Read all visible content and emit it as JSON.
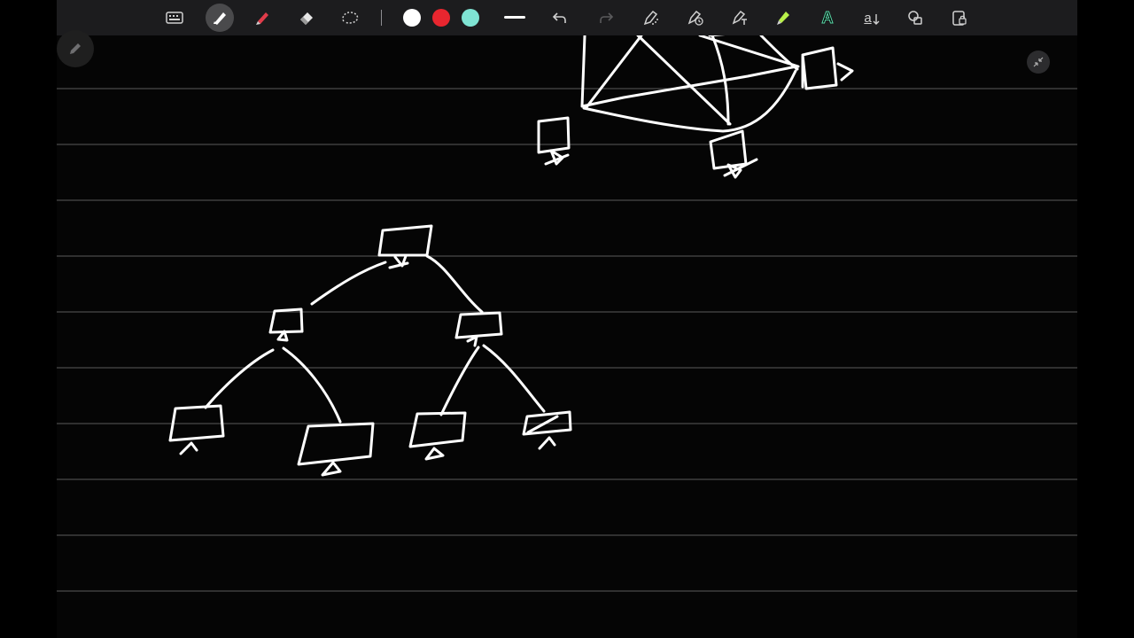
{
  "toolbar": {
    "tools": [
      {
        "name": "keyboard-icon",
        "active": false
      },
      {
        "name": "pen-icon",
        "active": true
      },
      {
        "name": "highlighter-icon",
        "active": false
      },
      {
        "name": "eraser-icon",
        "active": false
      },
      {
        "name": "lasso-icon",
        "active": false
      }
    ],
    "colors": {
      "white": "#ffffff",
      "red": "#e8262f",
      "teal": "#7fe3d3"
    },
    "stroke_width_icon": "stroke-width-icon",
    "undo_icon": "undo-icon",
    "redo_icon": "redo-icon",
    "extra_tools": [
      "magic-pen-icon",
      "timed-pen-icon",
      "text-pen-icon",
      "marker-icon",
      "ai-pen-icon",
      "text-icon",
      "shapes-icon",
      "lock-icon"
    ],
    "text_tool_label": "a",
    "ai_tool_label": "A"
  },
  "canvas": {
    "background": "#050505",
    "rule_color": "#5a5a5a",
    "ink_color": "#ffffff"
  },
  "floating": {
    "pen_icon": "pencil-icon",
    "collapse_icon": "collapse-icon"
  }
}
